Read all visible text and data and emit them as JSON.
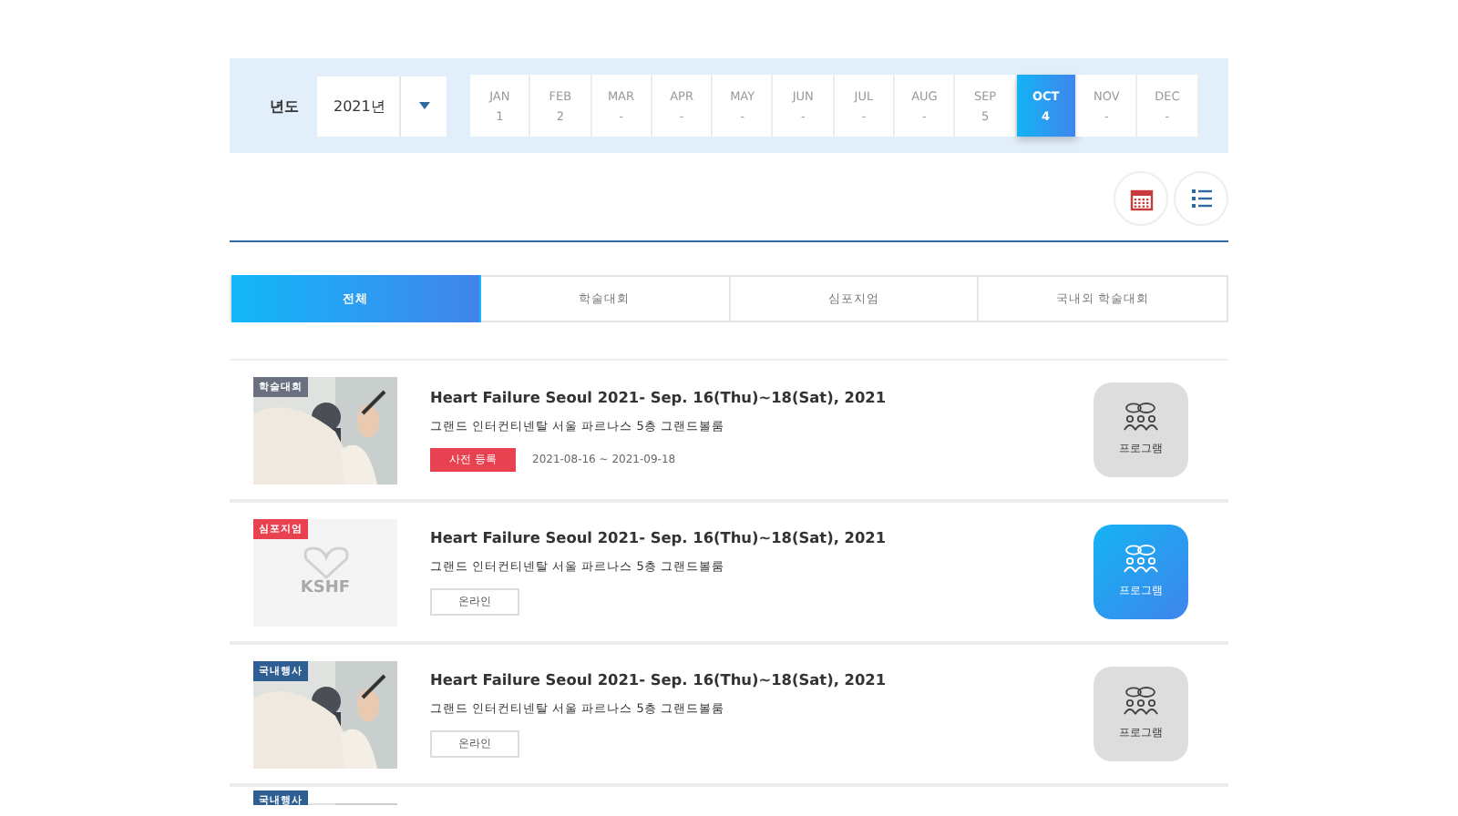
{
  "filter": {
    "label": "년도",
    "year_select": {
      "value": "2021년"
    },
    "months": [
      {
        "name": "JAN",
        "count": "1",
        "selected": false
      },
      {
        "name": "FEB",
        "count": "2",
        "selected": false
      },
      {
        "name": "MAR",
        "count": "-",
        "selected": false
      },
      {
        "name": "APR",
        "count": "-",
        "selected": false
      },
      {
        "name": "MAY",
        "count": "-",
        "selected": false
      },
      {
        "name": "JUN",
        "count": "-",
        "selected": false
      },
      {
        "name": "JUL",
        "count": "-",
        "selected": false
      },
      {
        "name": "AUG",
        "count": "-",
        "selected": false
      },
      {
        "name": "SEP",
        "count": "5",
        "selected": false
      },
      {
        "name": "OCT",
        "count": "4",
        "selected": true
      },
      {
        "name": "NOV",
        "count": "-",
        "selected": false
      },
      {
        "name": "DEC",
        "count": "-",
        "selected": false
      }
    ]
  },
  "view_buttons": [
    {
      "kind": "calendar",
      "selected": false
    },
    {
      "kind": "list",
      "selected": false
    }
  ],
  "tabs": [
    {
      "label": "전체",
      "selected": true
    },
    {
      "label": "학술대회",
      "selected": false
    },
    {
      "label": "심포지엄",
      "selected": false
    },
    {
      "label": "국내외 학술대회",
      "selected": false
    }
  ],
  "events": [
    {
      "tag": "학술대회",
      "color": "#6b7080",
      "title": "Heart Failure Seoul 2021- Sep. 16(Thu)~18(Sat), 2021",
      "venue": "그랜드 인터컨티넨탈 서울 파르나스 5층 그랜드볼룸",
      "badge": {
        "kind": "register",
        "label": "사전 등록"
      },
      "period": "2021-08-16 ~ 2021-09-18",
      "program": {
        "label": "프로그램",
        "selected": false
      }
    },
    {
      "tag": "심포지엄",
      "color": "#e8414f",
      "image": {
        "kind": "logo",
        "text": "KSHF"
      },
      "title": "Heart Failure Seoul 2021- Sep. 16(Thu)~18(Sat), 2021",
      "venue": "그랜드 인터컨티넨탈 서울 파르나스 5층 그랜드볼룸",
      "badge": {
        "kind": "online",
        "label": "온라인"
      },
      "program": {
        "label": "프로그램",
        "selected": true
      }
    },
    {
      "tag": "국내행사",
      "color": "#2f5e93",
      "title": "Heart Failure Seoul 2021- Sep. 16(Thu)~18(Sat), 2021",
      "venue": "그랜드 인터컨티넨탈 서울 파르나스 5층 그랜드볼룸",
      "badge": {
        "kind": "online",
        "label": "온라인"
      },
      "program": {
        "label": "프로그램",
        "selected": false
      }
    },
    {
      "tag": "국내행사",
      "color": "#2f5e93"
    }
  ]
}
